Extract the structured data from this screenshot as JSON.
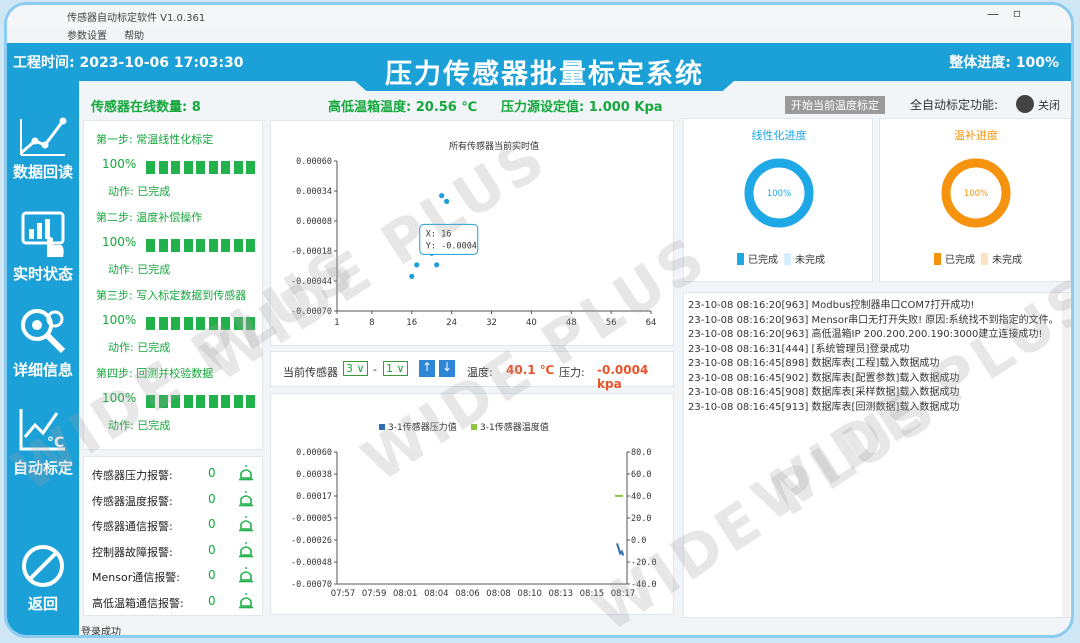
{
  "window": {
    "title": "传感器自动标定软件 V1.0.361"
  },
  "menu": {
    "items": [
      "参数设置",
      "帮助"
    ]
  },
  "header": {
    "time_label": "工程时间: 2023-10-06 17:03:30",
    "system_title": "压力传感器批量标定系统",
    "progress_label": "整体进度: 100%"
  },
  "sidebar": {
    "items": [
      {
        "label": "数据回读",
        "icon": "chart-line-icon"
      },
      {
        "label": "实时状态",
        "icon": "touch-monitor-icon"
      },
      {
        "label": "详细信息",
        "icon": "magnify-gear-icon"
      },
      {
        "label": "自动标定",
        "icon": "temperature-chart-icon"
      },
      {
        "label": "返回",
        "icon": "back-circle-icon"
      }
    ]
  },
  "infobar": {
    "online": "传感器在线数量: 8",
    "chamber_temp": "高低温箱温度: 20.56 ℃",
    "pressure_set": "压力源设定值: 1.000 Kpa",
    "start_button": "开始当前温度标定",
    "auto_label": "全自动标定功能:",
    "toggle_label": "关闭"
  },
  "steps": [
    {
      "title": "第一步: 常温线性化标定",
      "percent": "100%",
      "action": "动作:  已完成",
      "fill": 1.0
    },
    {
      "title": "第二步: 温度补偿操作",
      "percent": "100%",
      "action": "动作:  已完成",
      "fill": 1.0
    },
    {
      "title": "第三步: 写入标定数据到传感器",
      "percent": "100%",
      "action": "动作:  已完成",
      "fill": 1.0
    },
    {
      "title": "第四步: 回测并校验数据",
      "percent": "100%",
      "action": "动作:  已完成",
      "fill": 1.0
    }
  ],
  "alarms": [
    {
      "label": "传感器压力报警:",
      "count": "0"
    },
    {
      "label": "传感器温度报警:",
      "count": "0"
    },
    {
      "label": "传感器通信报警:",
      "count": "0"
    },
    {
      "label": "控制器故障报警:",
      "count": "0"
    },
    {
      "label": "Mensor通信报警:",
      "count": "0"
    },
    {
      "label": "高低温箱通信报警:",
      "count": "0"
    }
  ],
  "selector": {
    "label": "当前传感器",
    "value1": "3",
    "dash": "-",
    "value2": "1",
    "temp_label": "温度:",
    "temp_value": "40.1 ℃",
    "press_label": "压力:",
    "press_value": "-0.0004 kpa"
  },
  "progress_rings": [
    {
      "title": "线性化进度",
      "percent": "100%",
      "fraction": 1.0,
      "color": "#1fa8e6",
      "light": "#d6eefa",
      "legend_done": "已完成",
      "legend_todo": "未完成"
    },
    {
      "title": "温补进度",
      "percent": "100%",
      "fraction": 1.0,
      "color": "#f5930f",
      "light": "#fbe2c2",
      "legend_done": "已完成",
      "legend_todo": "未完成"
    }
  ],
  "log": [
    "23-10-08 08:16:20[963] Modbus控制器串口COM7打开成功!",
    "23-10-08 08:16:20[963] Mensor串口无打开失败! 原因:系统找不到指定的文件。",
    "23-10-08 08:16:20[963] 高低温箱IP 200.200.200.190:3000建立连接成功!",
    "23-10-08 08:16:31[444] [系统管理员]登录成功",
    "23-10-08 08:16:45[898] 数据库表[工程]载入数据成功",
    "23-10-08 08:16:45[902] 数据库表[配置参数]载入数据成功",
    "23-10-08 08:16:45[908] 数据库表[采样数据]载入数据成功",
    "23-10-08 08:16:45[913] 数据库表[回测数据]载入数据成功"
  ],
  "status_bar": "登录成功",
  "watermark": "WIDE PLUS",
  "chart_data": [
    {
      "type": "scatter",
      "title": "所有传感器当前实时值",
      "xlim": [
        1,
        64
      ],
      "ylim": [
        -0.0007,
        0.0006
      ],
      "xticks": [
        "1",
        "8",
        "16",
        "24",
        "32",
        "40",
        "48",
        "56",
        "64"
      ],
      "yticks": [
        "0.00060",
        "0.00034",
        "0.00008",
        "-0.00018",
        "-0.00044",
        "-0.00070"
      ],
      "points": [
        {
          "x": 16,
          "y": -0.0004
        },
        {
          "x": 17,
          "y": -0.0003
        },
        {
          "x": 18,
          "y": -0.0001
        },
        {
          "x": 19,
          "y": 0.0
        },
        {
          "x": 20,
          "y": -0.0002
        },
        {
          "x": 21,
          "y": -0.0003
        },
        {
          "x": 22,
          "y": 0.0003
        },
        {
          "x": 23,
          "y": 0.00025
        }
      ],
      "tooltip": {
        "x_label": "X: 16",
        "y_label": "Y: -0.0004"
      }
    },
    {
      "type": "line",
      "series": [
        {
          "name": "3-1传感器压力值",
          "color": "#2e6fb2",
          "axis": "left"
        },
        {
          "name": "3-1传感器温度值",
          "color": "#8cc63f",
          "axis": "right"
        }
      ],
      "x": [
        "07:57",
        "07:59",
        "08:01",
        "08:04",
        "08:06",
        "08:08",
        "08:10",
        "08:13",
        "08:15",
        "08:17"
      ],
      "yticks_left": [
        "0.00060",
        "0.00038",
        "0.00017",
        "-0.00005",
        "-0.00026",
        "-0.00048",
        "-0.00070"
      ],
      "yticks_right": [
        "80.0",
        "60.0",
        "40.0",
        "20.0",
        "0.0",
        "-20.0",
        "-40.0"
      ],
      "ylim_left": [
        -0.0007,
        0.0006
      ],
      "ylim_right": [
        -40,
        80
      ],
      "pressure_tail": [
        -0.0003,
        -0.00035,
        -0.0004,
        -0.00038,
        -0.00042
      ],
      "temperature_tail": [
        40.1,
        40.1,
        40.1
      ]
    }
  ]
}
